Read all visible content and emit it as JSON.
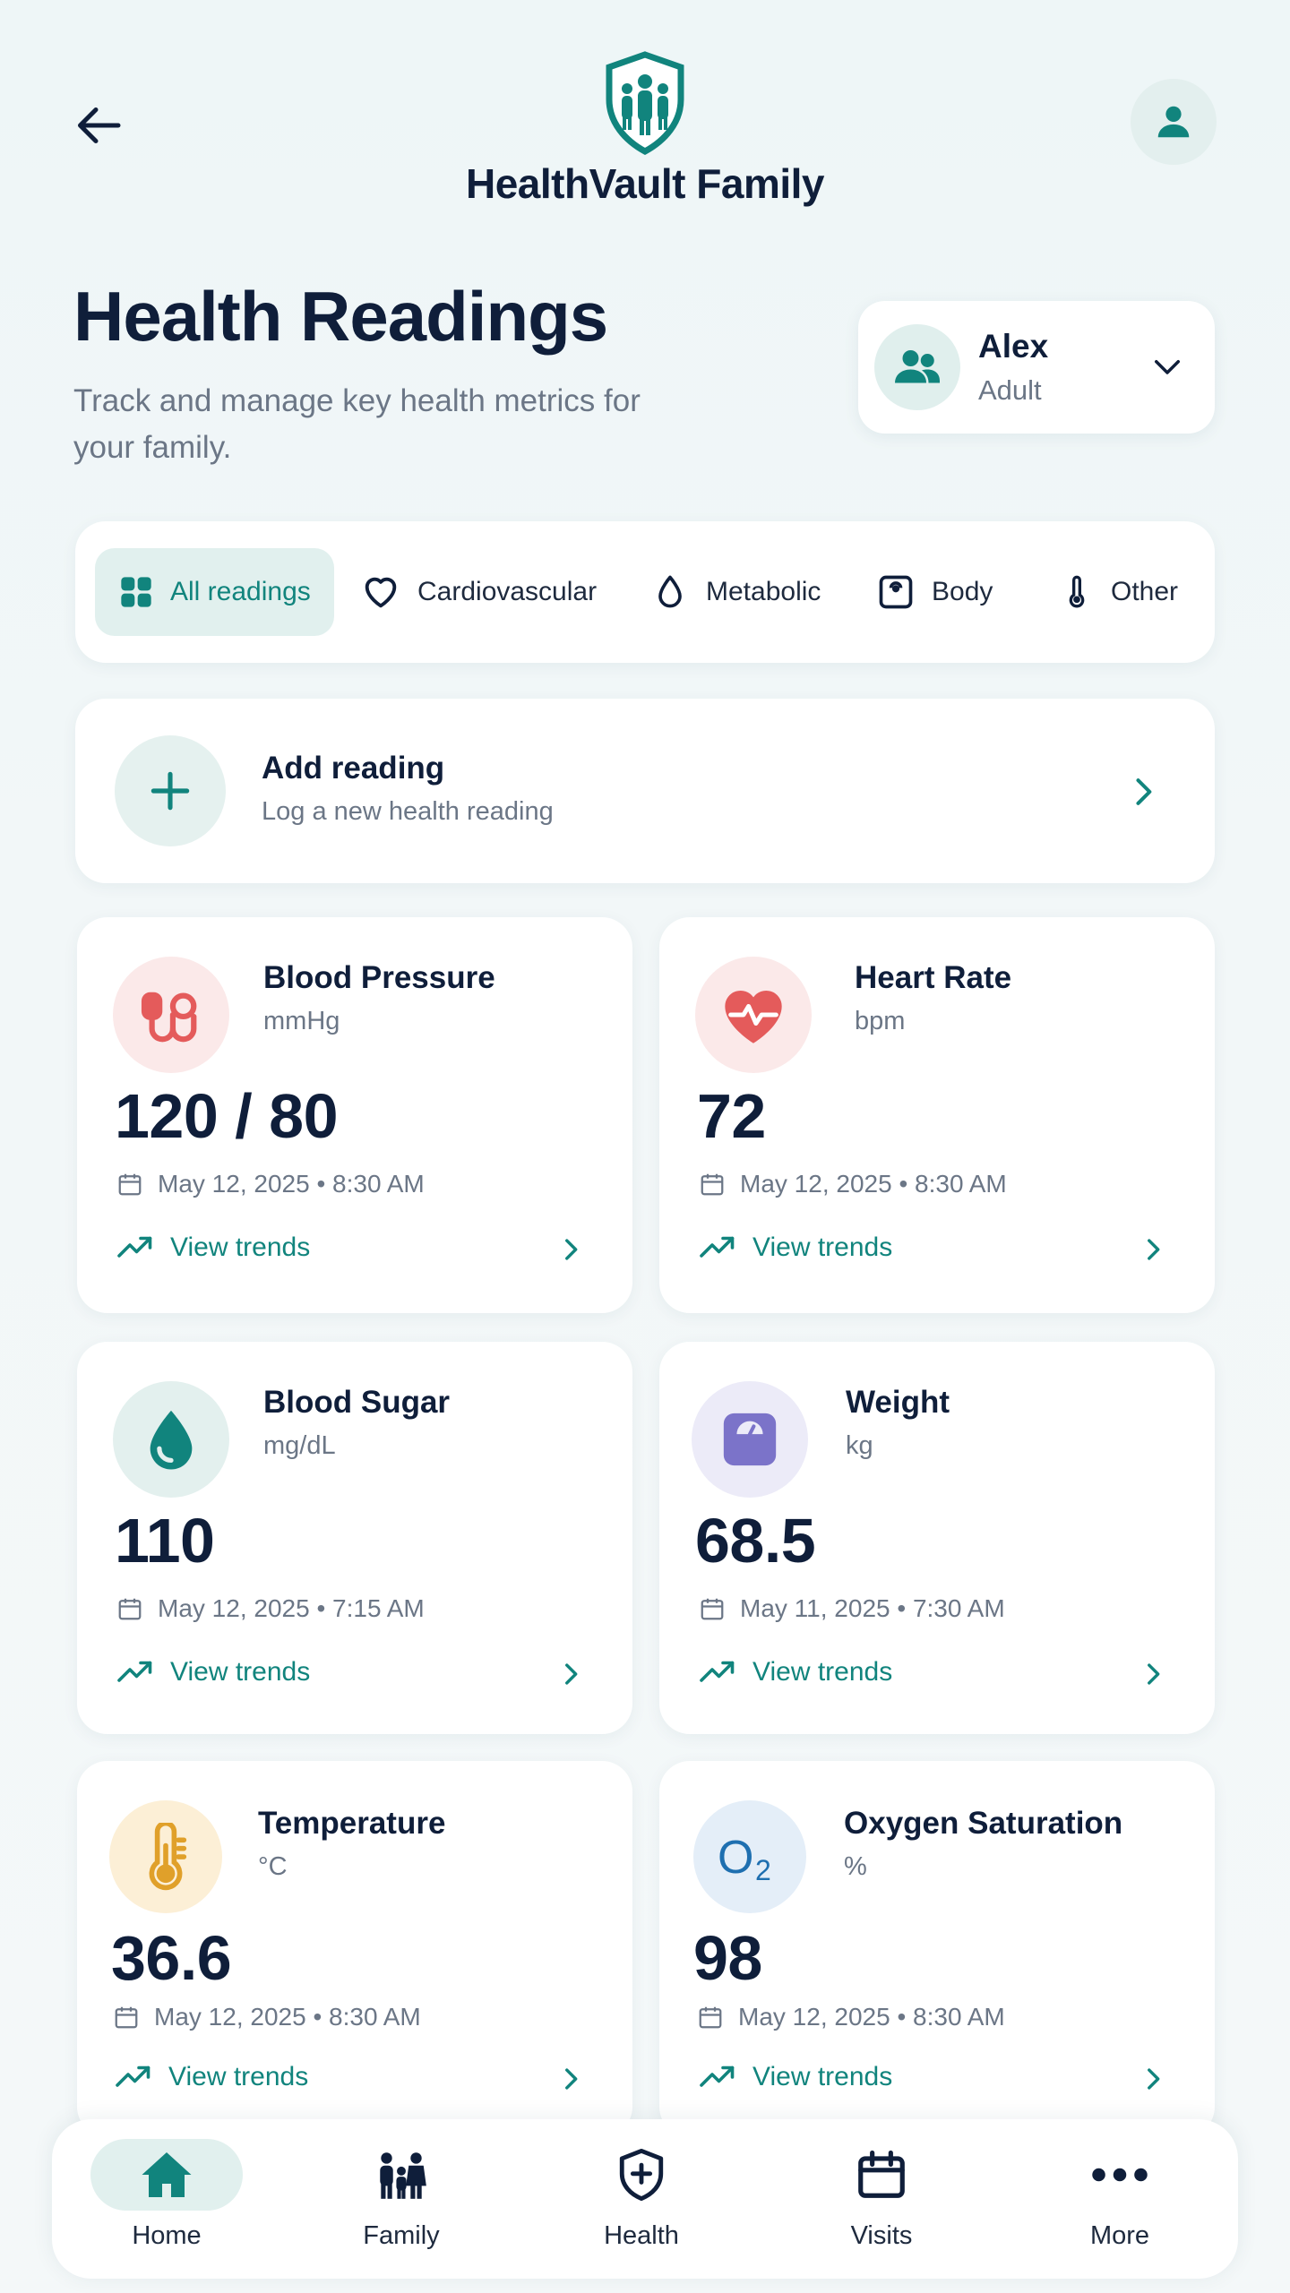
{
  "header": {
    "app_title": "HealthVault Family"
  },
  "page": {
    "title": "Health Readings",
    "subtitle": "Track and manage key health metrics for your family."
  },
  "member": {
    "name": "Alex",
    "role": "Adult"
  },
  "filters": [
    {
      "label": "All readings",
      "icon": "grid-icon",
      "active": true
    },
    {
      "label": "Cardiovascular",
      "icon": "heart-icon"
    },
    {
      "label": "Metabolic",
      "icon": "drop-icon"
    },
    {
      "label": "Body",
      "icon": "scale-icon"
    },
    {
      "label": "Other",
      "icon": "thermometer-icon"
    }
  ],
  "add_reading": {
    "title": "Add reading",
    "subtitle": "Log a new health reading"
  },
  "readings": [
    {
      "name": "Blood Pressure",
      "unit": "mmHg",
      "value": "120 / 80",
      "date": "May 12, 2025 • 8:30 AM",
      "trend_label": "View trends",
      "icon": "blood-pressure-icon",
      "color": "#e45b5b"
    },
    {
      "name": "Heart Rate",
      "unit": "bpm",
      "value": "72",
      "date": "May 12, 2025 • 8:30 AM",
      "trend_label": "View trends",
      "icon": "heart-rate-icon",
      "color": "#e45b5b"
    },
    {
      "name": "Blood Sugar",
      "unit": "mg/dL",
      "value": "110",
      "date": "May 12, 2025 • 7:15 AM",
      "trend_label": "View trends",
      "icon": "blood-drop-icon",
      "color": "#11847d"
    },
    {
      "name": "Weight",
      "unit": "kg",
      "value": "68.5",
      "date": "May 11, 2025 • 7:30 AM",
      "trend_label": "View trends",
      "icon": "weight-scale-icon",
      "color": "#7b73c9"
    },
    {
      "name": "Temperature",
      "unit": "°C",
      "value": "36.6",
      "date": "May 12, 2025 • 8:30 AM",
      "trend_label": "View trends",
      "icon": "thermometer-icon",
      "color": "#e0a02a"
    },
    {
      "name": "Oxygen Saturation",
      "unit": "%",
      "value": "98",
      "date": "May 12, 2025 • 8:30 AM",
      "trend_label": "View trends",
      "icon": "oxygen-icon",
      "color": "#1e6fb0"
    }
  ],
  "nav": [
    {
      "label": "Home",
      "icon": "home-icon",
      "active": true
    },
    {
      "label": "Family",
      "icon": "family-icon"
    },
    {
      "label": "Health",
      "icon": "health-shield-icon"
    },
    {
      "label": "Visits",
      "icon": "calendar-icon"
    },
    {
      "label": "More",
      "icon": "more-icon"
    }
  ],
  "colors": {
    "accent": "#11847d",
    "text": "#0f1e3a",
    "muted": "#6b7686",
    "background": "#eef6f7"
  }
}
